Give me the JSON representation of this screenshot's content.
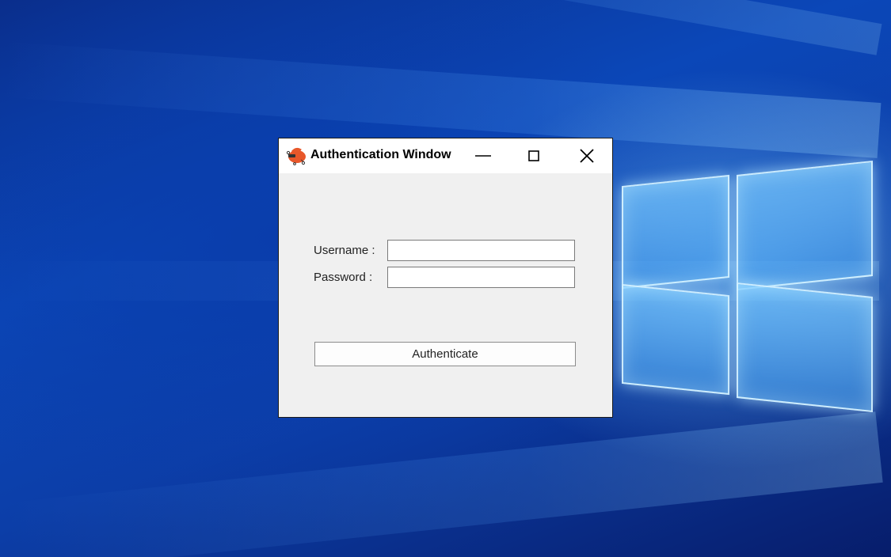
{
  "desktop": {
    "wallpaper": "windows-10-hero",
    "accent": "#0b47b8"
  },
  "window": {
    "title": "Authentication Window",
    "icon": "app-logo-icon",
    "controls": {
      "minimize": "minimize-icon",
      "maximize": "maximize-icon",
      "close": "close-icon"
    }
  },
  "form": {
    "username_label": "Username :",
    "username_value": "",
    "password_label": "Password :",
    "password_value": "",
    "submit_label": "Authenticate"
  }
}
